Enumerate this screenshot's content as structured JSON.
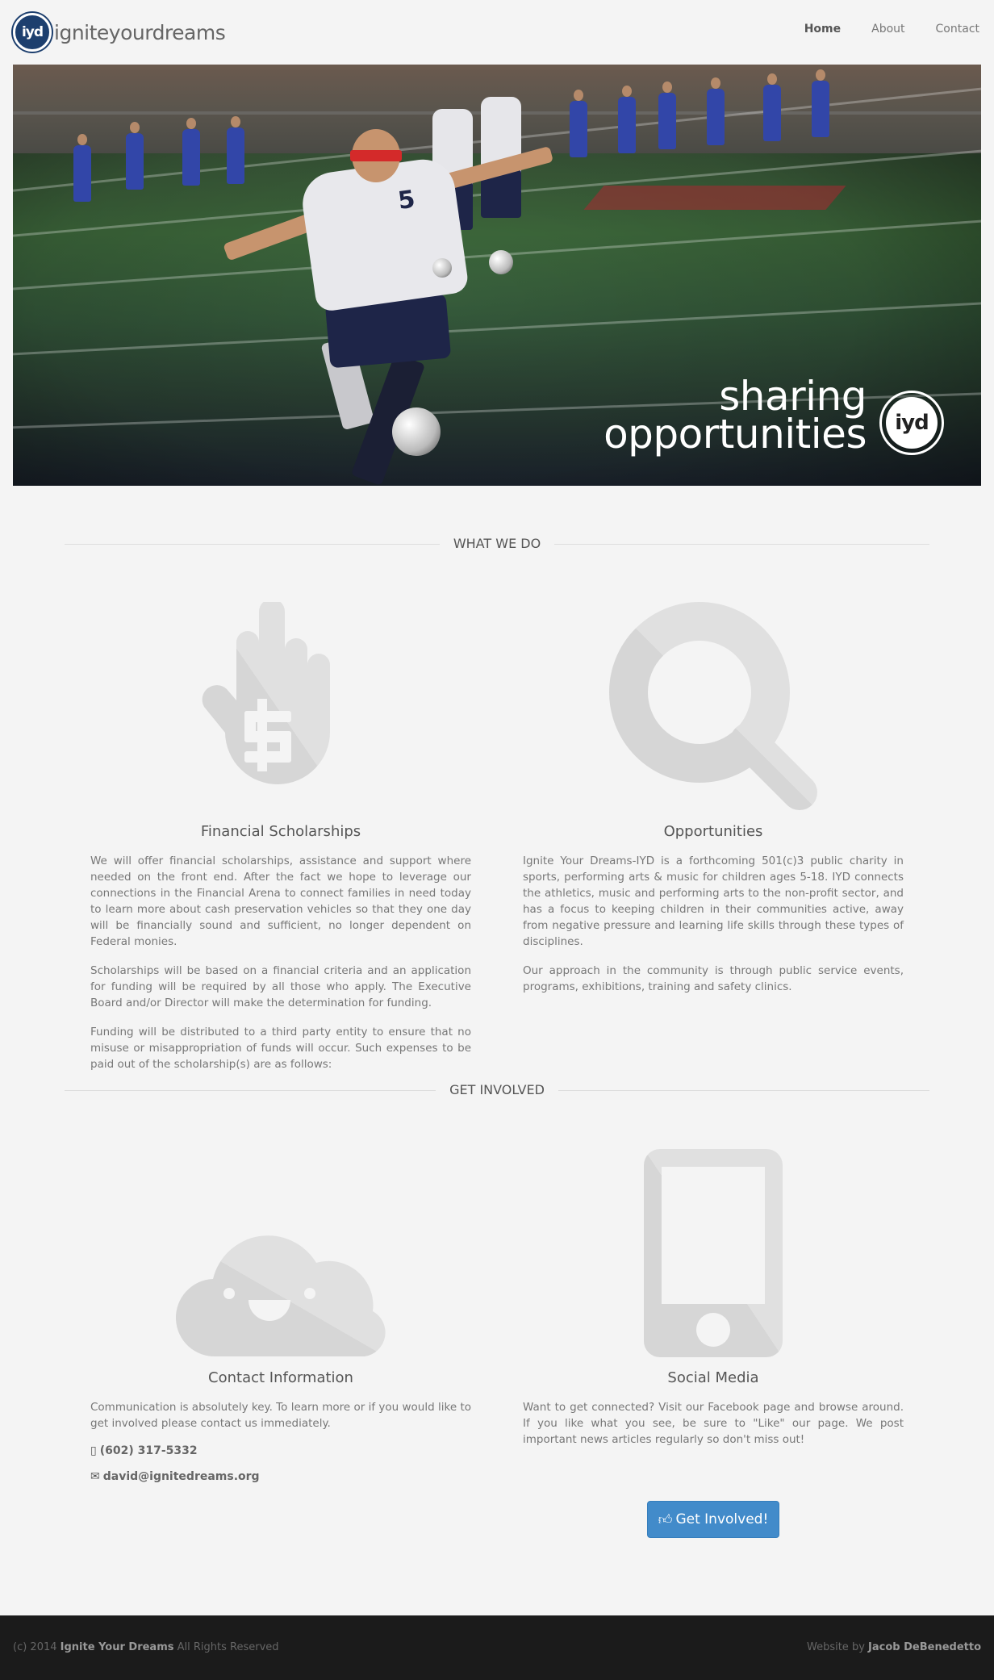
{
  "brand": {
    "logo_text": "iyd",
    "name": "igniteyourdreams"
  },
  "nav": {
    "home": "Home",
    "about": "About",
    "contact": "Contact"
  },
  "hero": {
    "caption_line1": "sharing",
    "caption_line2": "opportunities",
    "badge_text": "iyd",
    "shirt_number": "5"
  },
  "what_we_do": {
    "heading": "WHAT WE DO",
    "scholarships": {
      "title": "Financial Scholarships",
      "icon": "hand-dollar-icon",
      "p1": "We will offer financial scholarships, assistance and support where needed on the front end. After the fact we hope to leverage our connections in the Financial Arena to connect families in need today to learn more about cash preservation vehicles so that they one day will be financially sound and sufficient, no longer dependent on Federal monies.",
      "p2": "Scholarships will be based on a financial criteria and an application for funding will be required by all those who apply. The Executive Board and/or Director will make the determination for funding.",
      "p3": "Funding will be distributed to a third party entity to ensure that no misuse or misappropriation of funds will occur. Such expenses to be paid out of the scholarship(s) are as follows:"
    },
    "opportunities": {
      "title": "Opportunities",
      "icon": "magnifier-icon",
      "p1": "Ignite Your Dreams-IYD is a forthcoming 501(c)3 public charity in sports, performing arts & music for children ages 5-18. IYD connects the athletics, music and performing arts to the non-profit sector, and has a focus to keeping children in their communities active, away from negative pressure and learning life skills through these types of disciplines.",
      "p2": "Our approach in the community is through public service events, programs, exhibitions, training and safety clinics."
    }
  },
  "get_involved": {
    "heading": "GET INVOLVED",
    "contact": {
      "title": "Contact Information",
      "icon": "smiling-cloud-icon",
      "p1": "Communication is absolutely key. To learn more or if you would like to get involved please contact us immediately.",
      "phone": "(602) 317-5332",
      "email": "david@ignitedreams.org"
    },
    "social": {
      "title": "Social Media",
      "icon": "smartphone-icon",
      "p1": "Want to get connected? Visit our Facebook page and browse around. If you like what you see, be sure to \"Like\" our page. We post important news articles regularly so don't miss out!",
      "button": "Get Involved!"
    }
  },
  "footer": {
    "copyright_prefix": "(c) 2014",
    "org": "Ignite Your Dreams",
    "rights": "All Rights Reserved",
    "credit_prefix": "Website by",
    "credit_name": "Jacob DeBenedetto"
  }
}
